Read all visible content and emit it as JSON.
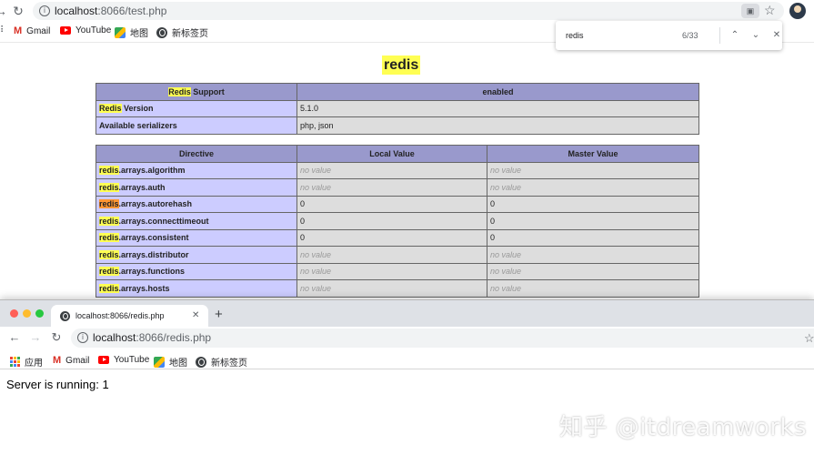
{
  "back_window": {
    "url_host": "localhost",
    "url_path": ":8066/test.php",
    "bookmarks": [
      {
        "icon": "gmail-icon",
        "label": "Gmail"
      },
      {
        "icon": "youtube-icon",
        "label": "YouTube"
      },
      {
        "icon": "maps-icon",
        "label": "地图"
      },
      {
        "icon": "globe-icon",
        "label": "新标签页"
      }
    ],
    "find_bar": {
      "query": "redis",
      "count": "6/33"
    },
    "page": {
      "title": "redis",
      "summary_table": {
        "header": {
          "name_prefix": "Redis",
          "name_suffix": " Support",
          "value": "enabled"
        },
        "rows": [
          {
            "name_prefix": "Redis",
            "name_suffix": " Version",
            "value": "5.1.0"
          },
          {
            "name_prefix": "",
            "name_suffix": "Available serializers",
            "value": "php, json"
          }
        ]
      },
      "directive_table": {
        "headers": [
          "Directive",
          "Local Value",
          "Master Value"
        ],
        "rows": [
          {
            "prefix": "redis",
            "suffix": ".arrays.algorithm",
            "local": "no value",
            "master": "no value",
            "novalue": true
          },
          {
            "prefix": "redis",
            "suffix": ".arrays.auth",
            "local": "no value",
            "master": "no value",
            "novalue": true
          },
          {
            "prefix": "redis",
            "suffix": ".arrays.autorehash",
            "local": "0",
            "master": "0",
            "novalue": false,
            "current": true
          },
          {
            "prefix": "redis",
            "suffix": ".arrays.connecttimeout",
            "local": "0",
            "master": "0",
            "novalue": false
          },
          {
            "prefix": "redis",
            "suffix": ".arrays.consistent",
            "local": "0",
            "master": "0",
            "novalue": false
          },
          {
            "prefix": "redis",
            "suffix": ".arrays.distributor",
            "local": "no value",
            "master": "no value",
            "novalue": true
          },
          {
            "prefix": "redis",
            "suffix": ".arrays.functions",
            "local": "no value",
            "master": "no value",
            "novalue": true
          },
          {
            "prefix": "redis",
            "suffix": ".arrays.hosts",
            "local": "no value",
            "master": "no value",
            "novalue": true
          }
        ]
      }
    }
  },
  "front_window": {
    "tab_title": "localhost:8066/redis.php",
    "url_host": "localhost",
    "url_path": ":8066/redis.php",
    "bookmarks": [
      {
        "icon": "apps-icon",
        "label": "应用"
      },
      {
        "icon": "gmail-icon",
        "label": "Gmail"
      },
      {
        "icon": "youtube-icon",
        "label": "YouTube"
      },
      {
        "icon": "maps-icon",
        "label": "地图"
      },
      {
        "icon": "globe-icon",
        "label": "新标签页"
      }
    ],
    "content": "Server is running: 1"
  },
  "watermark": "知乎 @itdreamworks",
  "colors": {
    "highlight": "#ffff53",
    "current_highlight": "#ff9632",
    "table_header": "#9999cc",
    "table_key": "#ccccff",
    "table_value": "#dddddd"
  }
}
